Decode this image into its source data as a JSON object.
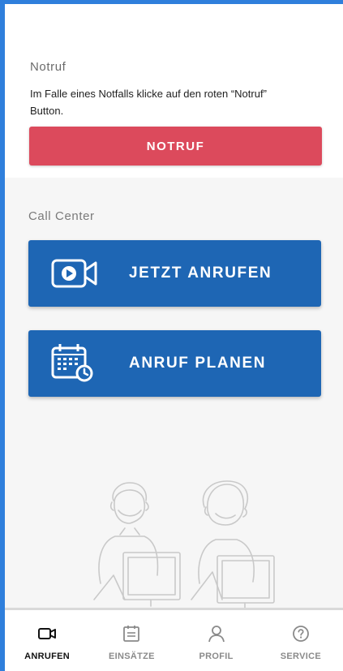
{
  "emergency": {
    "heading": "Notruf",
    "description": "Im Falle eines Notfalls klicke auf den roten “Notruf” Button.",
    "button_label": "NOTRUF"
  },
  "call_center": {
    "heading": "Call Center",
    "call_now_label": "JETZT ANRUFEN",
    "schedule_label": "ANRUF PLANEN"
  },
  "bottom_nav": {
    "items": [
      {
        "label": "ANRUFEN",
        "icon": "video-camera-icon",
        "active": true
      },
      {
        "label": "EINSÄTZE",
        "icon": "clipboard-list-icon",
        "active": false
      },
      {
        "label": "PROFIL",
        "icon": "user-icon",
        "active": false
      },
      {
        "label": "SERVICE",
        "icon": "help-circle-icon",
        "active": false
      }
    ]
  },
  "colors": {
    "frame_blue": "#2f7fdc",
    "emergency_red": "#dc4a5c",
    "call_blue": "#1e66b4",
    "background_gray": "#f6f6f6"
  }
}
